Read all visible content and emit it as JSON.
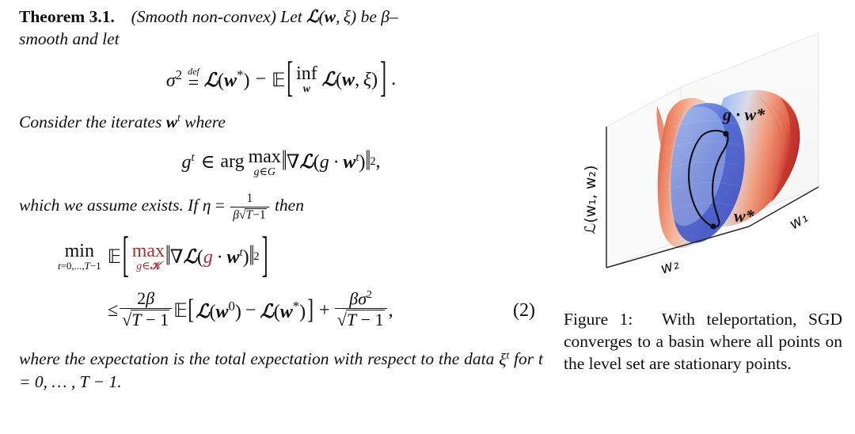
{
  "document": {
    "kind": "academic-paper-excerpt",
    "background_color": "#ffffff",
    "text_color": "#100f0f",
    "accent_red": "#a62f2f"
  },
  "theorem": {
    "label": "Theorem 3.1.",
    "qualifier": "(Smooth non-convex)",
    "intro_part1": "Let",
    "intro_loss": "ℒ(w, ξ)",
    "intro_part2": "be",
    "intro_beta": "β–",
    "intro_part3": "smooth and let",
    "consider_line": "Consider the iterates",
    "consider_iterate": "w",
    "consider_where": "where",
    "assume_line": "which we assume exists. If",
    "assume_eta": "η",
    "assume_eq": "=",
    "assume_then": "then",
    "closing_line1": "where the expectation is the total expectation with respect to",
    "closing_line2_a": "the data",
    "closing_line2_xi": "ξ",
    "closing_line2_b": "for t = 0, … , T − 1."
  },
  "equations": {
    "sigma_def": {
      "lhs_sym": "σ",
      "lhs_exp": "2",
      "rel": "=",
      "rel_over": "def",
      "term1": "ℒ(w*)",
      "minus": "−",
      "expect": "ᴇ",
      "inf_op": "inf",
      "inf_sub": "w",
      "inner": "ℒ(w, ξ)",
      "period": "."
    },
    "argmax": {
      "lhs": "g",
      "lhs_sup": "t",
      "in": "∈",
      "arg": "arg",
      "op": "max",
      "lim": "g∈G",
      "norm_open": "‖",
      "grad": "∇ℒ(g · w",
      "grad_sup": "t",
      "grad_close": ")",
      "norm_close": "‖",
      "power": "2",
      "comma": ","
    },
    "eta_value": {
      "numerator": "1",
      "denominator_beta": "β",
      "denominator_root": "T−1"
    },
    "main": {
      "number": "(2)",
      "min_op": "min",
      "min_lim": "t=0,...,T−1",
      "expect": "ᴇ",
      "max_op": "max",
      "max_lim": "g∈𝒢",
      "grad_norm": "‖∇ℒ(g · w",
      "grad_sup": "t",
      "grad_tail": ")‖",
      "grad_power": "2",
      "leq": "≤",
      "frac1_num": "2β",
      "frac1_den": "√T − 1",
      "bracket_open": "[",
      "inner_a": "ℒ(w",
      "inner_a_sup": "0",
      "inner_a_close": ")",
      "inner_minus": "−",
      "inner_b": "ℒ(w*)",
      "bracket_close": "]",
      "plus": "+",
      "frac2_num": "βσ",
      "frac2_num_sup": "2",
      "frac2_den": "√T − 1",
      "trailing_comma": ","
    }
  },
  "figure": {
    "number": "Figure 1:",
    "caption": "With teleportation, SGD converges to a basin where all points on the level set are stationary points.",
    "axes": {
      "z_label": "ℒ(w₁, w₂)",
      "x_label": "w₂",
      "y_label": "w₁"
    },
    "annotations": {
      "teleported_point": "g · w*",
      "optimum_point": "w*"
    },
    "style": {
      "colormap": "coolwarm",
      "surface_blue": "#3b4cc0",
      "surface_midblue": "#7b9ff9",
      "surface_pale": "#dddddd",
      "surface_salmon": "#f4987a",
      "surface_red": "#b40426",
      "pane_color": "#fafafa",
      "pane_edge": "#dcdcdc",
      "axis_line": "#2b2b2b",
      "contour_color": "#111111"
    }
  }
}
